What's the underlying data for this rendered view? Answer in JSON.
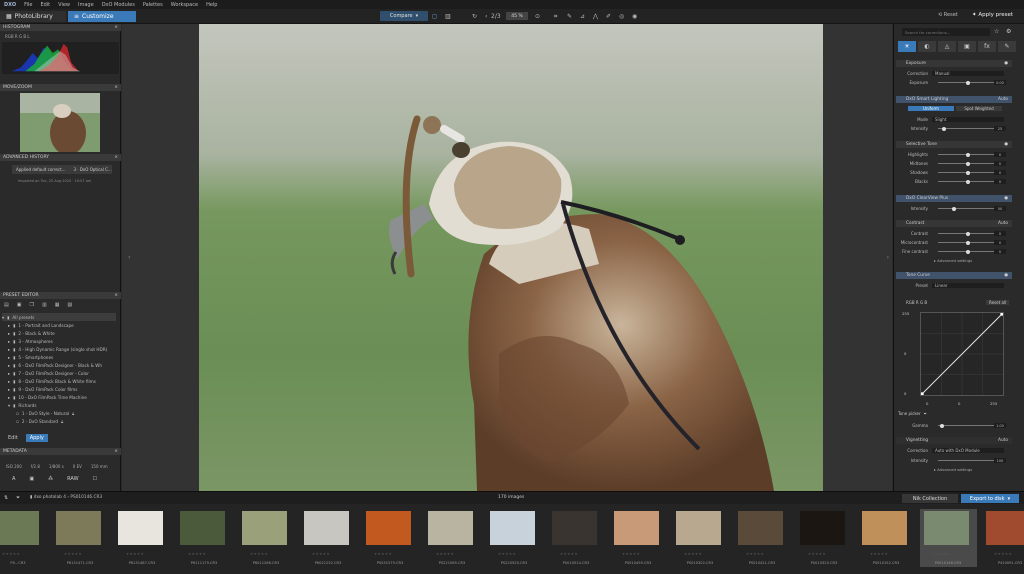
{
  "app": {
    "logo": "DXO",
    "menu": [
      "File",
      "Edit",
      "View",
      "Image",
      "DxO Modules",
      "Palettes",
      "Workspace",
      "Help"
    ]
  },
  "toolbar": {
    "tab_library": "PhotoLibrary",
    "tab_customize": "Customize",
    "compare": "Compare",
    "page": "2/3",
    "zoom": "45 %",
    "reset": "Reset",
    "apply_preset": "Apply preset"
  },
  "left": {
    "histogram": "HISTOGRAM",
    "hist_channels": "RGB R G B L",
    "movezoom": "MOVE/ZOOM",
    "advanced_history": "ADVANCED HISTORY",
    "history_item": "Applied default correct...",
    "history_item2": "3 · DxO Optical C...",
    "history_note": "Imported on Tue, 25 Aug 2020 · 10:07 am",
    "preset_editor": "PRESET EDITOR",
    "presets": [
      "All presets",
      "1 - Portrait and Landscape",
      "2 - Black & White",
      "3 - Atmospheres",
      "4 - High Dynamic Range (single shot HDR)",
      "5 - Smartphones",
      "6 - DxO FilmPack Designer - Black & Wh",
      "7 - DxO FilmPack Designer - Color",
      "8 - DxO FilmPack Black & White films",
      "9 - DxO FilmPack Color films",
      "10 - DxO FilmPack Time Machine",
      "Richards",
      "1 - DxO Style - Natural",
      "2 - DxO Standard"
    ],
    "tab_edit": "Edit",
    "tab_apply": "Apply",
    "metadata": "METADATA",
    "meta": [
      "ISO 200",
      "f/2.8",
      "1/800 s",
      "0 EV",
      "150 mm"
    ],
    "meta_icons": [
      "A",
      "▣",
      "⁂",
      "RAW",
      "☐"
    ]
  },
  "right": {
    "search_placeholder": "Search for corrections...",
    "sections": {
      "exposure": "Exposure",
      "correction": "Correction",
      "correction_val": "Manual",
      "exposure_lbl": "Exposure",
      "exposure_val": "0.00",
      "smart_lighting": "DxO Smart Lighting",
      "auto": "Auto",
      "uniform": "Uniform",
      "spot_weighted": "Spot Weighted",
      "mode": "Mode",
      "mode_val": "Slight",
      "intensity": "Intensity",
      "intensity_val": "25",
      "selective_tone": "Selective Tone",
      "highlights": "Highlights",
      "midtones": "Midtones",
      "shadows": "Shadows",
      "blacks": "Blacks",
      "clearview": "DxO ClearView Plus",
      "cv_intensity_val": "50",
      "contrast": "Contrast",
      "contrast_lbl": "Contrast",
      "microcontrast": "Microcontrast",
      "fine_contrast": "Fine contrast",
      "advanced": "Advanced settings",
      "tone_curve": "Tone Curve",
      "preset": "Preset",
      "preset_val": "Linear",
      "channels": "RGB R G B",
      "reset_all": "Reset all",
      "curve_top": "255",
      "curve_mid": "0",
      "curve_zero": "0",
      "curve_in0": "0",
      "curve_in1": "0",
      "curve_in255": "255",
      "tone_picker": "Tone picker",
      "gamma": "Gamma",
      "gamma_val": "1.00",
      "vignetting": "Vignetting",
      "vig_correction_val": "Auto with DxO Module",
      "vig_intensity_val": "100",
      "vig_advanced": "Advanced settings"
    }
  },
  "filmbar": {
    "folder": "dxo photolab 4 › PS010146.CR3",
    "count": "170 images",
    "nik": "Nik Collection",
    "export": "Export to disk"
  },
  "filmstrip": [
    {
      "name": "PS...CR3",
      "color": "#6b7a55"
    },
    {
      "name": "P6131471.CR3",
      "color": "#7d7a5a"
    },
    {
      "name": "P6131487.CR3",
      "color": "#e8e4de"
    },
    {
      "name": "P6111179.CR3",
      "color": "#4a5a3a"
    },
    {
      "name": "P6011266.CR3",
      "color": "#9aa07a"
    },
    {
      "name": "P6021232.CR3",
      "color": "#c8c6c0"
    },
    {
      "name": "PS031579.CR3",
      "color": "#c25a20"
    },
    {
      "name": "PS221065.CR3",
      "color": "#b9b4a2"
    },
    {
      "name": "PS220520.CR3",
      "color": "#c8d2da"
    },
    {
      "name": "PS010514.CR3",
      "color": "#3a3430"
    },
    {
      "name": "PS010495.CR3",
      "color": "#c89a78"
    },
    {
      "name": "PS010302.CR3",
      "color": "#b8a890"
    },
    {
      "name": "PS010421.CR3",
      "color": "#5a4a3a"
    },
    {
      "name": "PS010325.CR3",
      "color": "#1c1612"
    },
    {
      "name": "PS010152.CR3",
      "color": "#c0905a"
    },
    {
      "name": "PS010146.CR3",
      "color": "#7a8a70"
    },
    {
      "name": "P410091.CR3",
      "color": "#a04a30"
    }
  ],
  "colors": {
    "accent": "#3a7ab8"
  }
}
